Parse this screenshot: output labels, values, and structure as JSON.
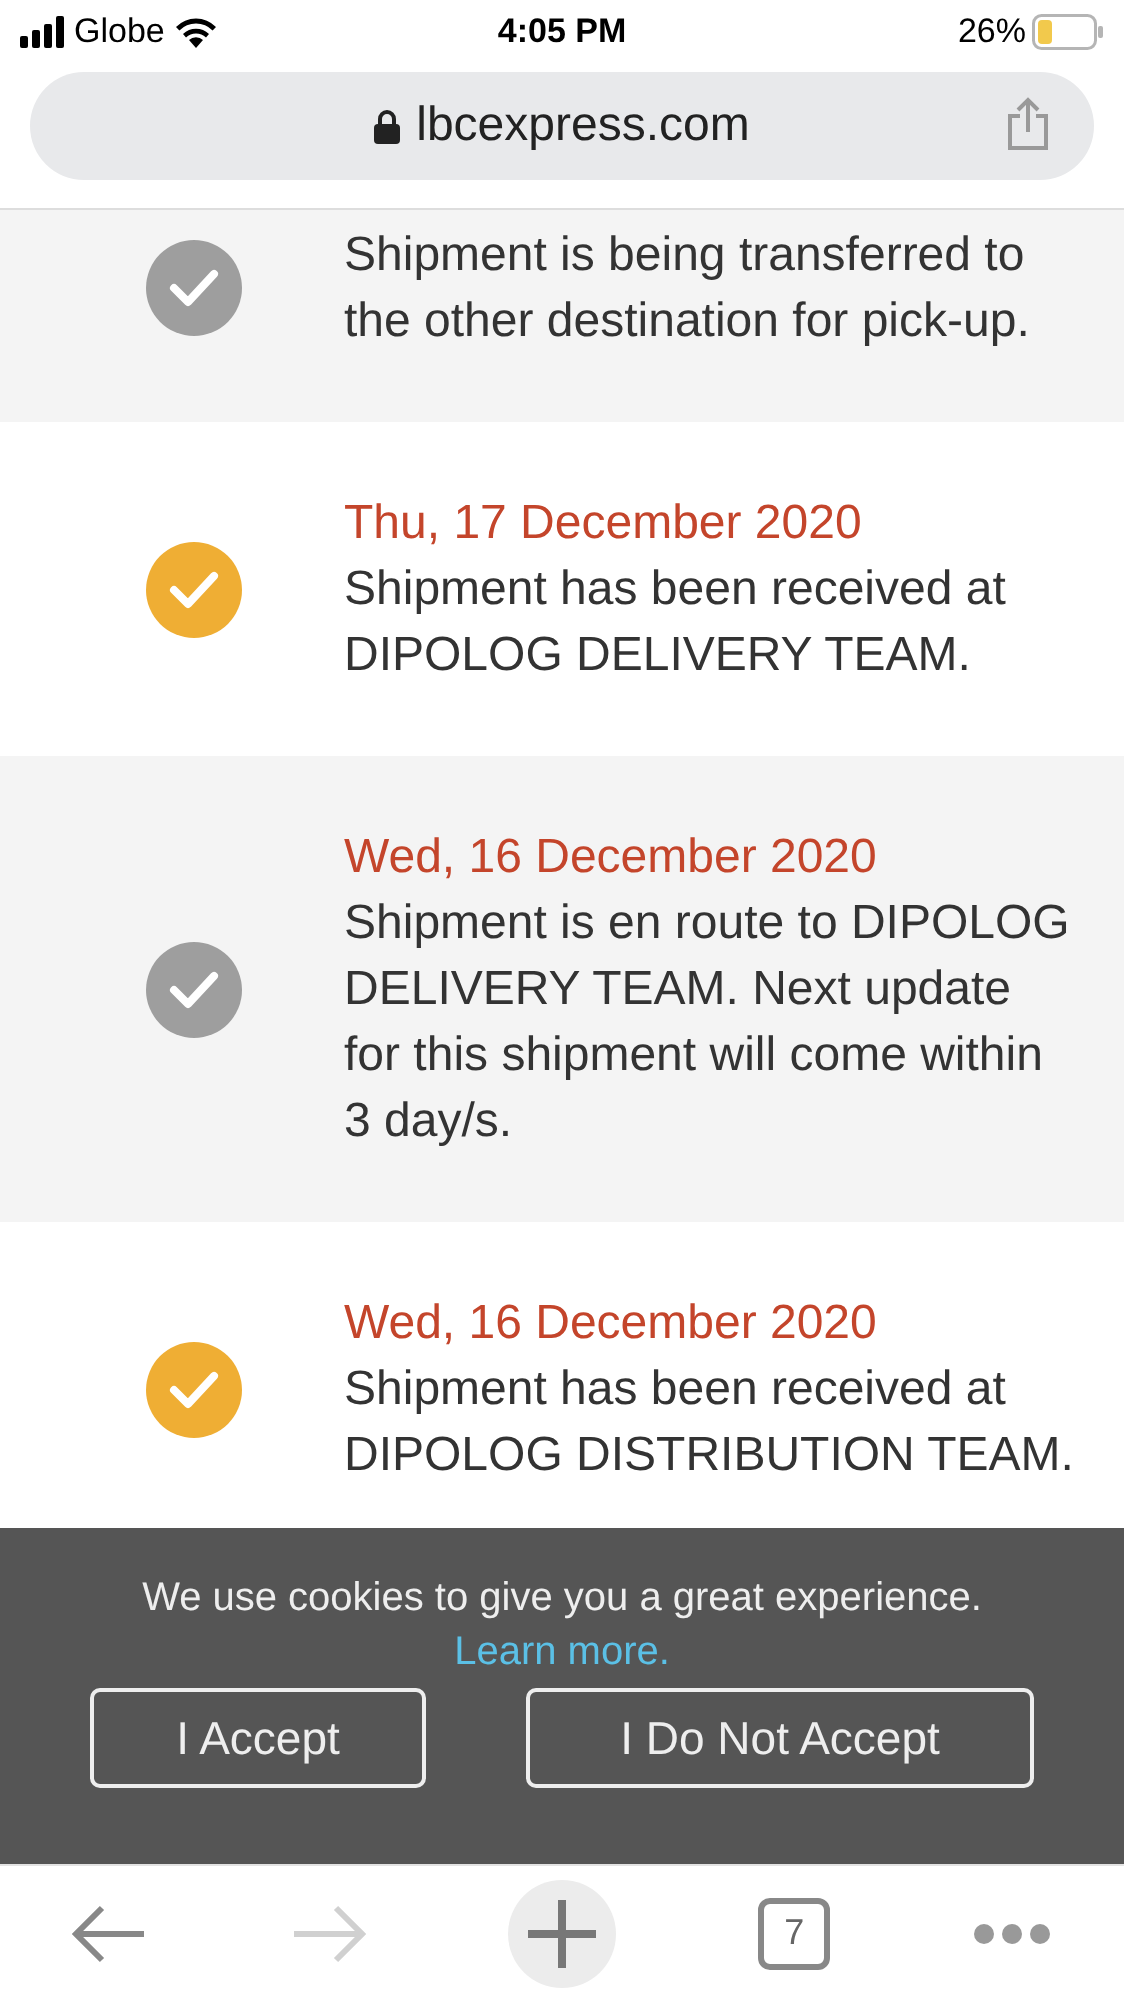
{
  "status_bar": {
    "carrier": "Globe",
    "time": "4:05 PM",
    "battery": "26%"
  },
  "address_bar": {
    "url": "lbcexpress.com"
  },
  "tracking_events": [
    {
      "text": "Shipment is being transferred to the other destination for pick-up.",
      "color": "#9e9e9e"
    },
    {
      "date": "Thu, 17 December 2020",
      "text": "Shipment has been received at DIPOLOG DELIVERY TEAM.",
      "color": "#efae34"
    },
    {
      "date": "Wed, 16 December 2020",
      "text": "Shipment is en route to DIPOLOG DELIVERY TEAM. Next update for this shipment will come within 3 day/s.",
      "color": "#9e9e9e"
    },
    {
      "date": "Wed, 16 December 2020",
      "text": "Shipment has been received at DIPOLOG DISTRIBUTION TEAM.",
      "color": "#efae34"
    }
  ],
  "cookie_banner": {
    "message": "We use cookies to give you a great experience.",
    "link": "Learn more.",
    "buttons": [
      "I Accept",
      "I Do Not Accept"
    ]
  },
  "toolbar": {
    "back_disabled": false,
    "forward_disabled": true,
    "tab_count": "7"
  }
}
